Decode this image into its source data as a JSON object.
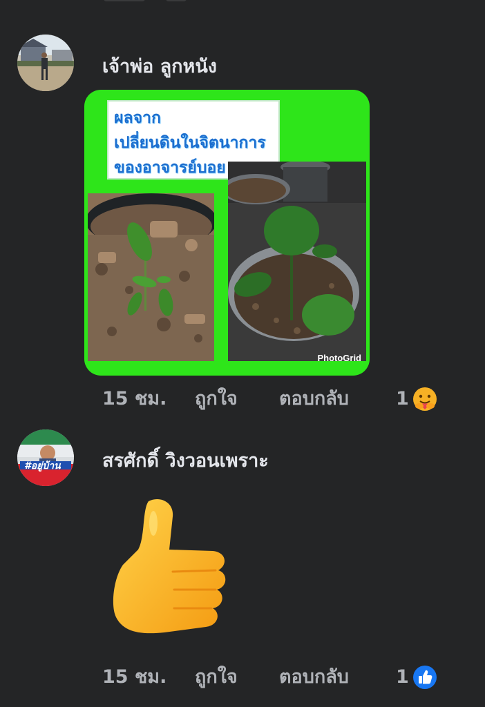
{
  "comments": [
    {
      "author": "เจ้าพ่อ ลูกหนัง",
      "attachment": {
        "caption_lines": [
          "ผลจาก",
          "เปลี่ยนดินในจิตนาการ",
          "ของอาจารย์บอย"
        ],
        "watermark": "PhotoGrid"
      },
      "time": "15 ชม.",
      "like_label": "ถูกใจ",
      "reply_label": "ตอบกลับ",
      "reaction_count": "1",
      "reaction_icon": "care-reaction-icon"
    },
    {
      "author": "สรศักดิ์ วิงวอนเพราะ",
      "avatar_text": "#อยู่บ้าน",
      "sticker": "thumbs-up-emoji",
      "time": "15 ชม.",
      "like_label": "ถูกใจ",
      "reply_label": "ตอบกลับ",
      "reaction_count": "1",
      "reaction_icon": "like-reaction-icon"
    }
  ],
  "colors": {
    "background": "#242526",
    "text_primary": "#e4e6eb",
    "text_secondary": "#b0b3b8",
    "like_blue": "#1877f2",
    "frame_green": "#2ee51a"
  }
}
